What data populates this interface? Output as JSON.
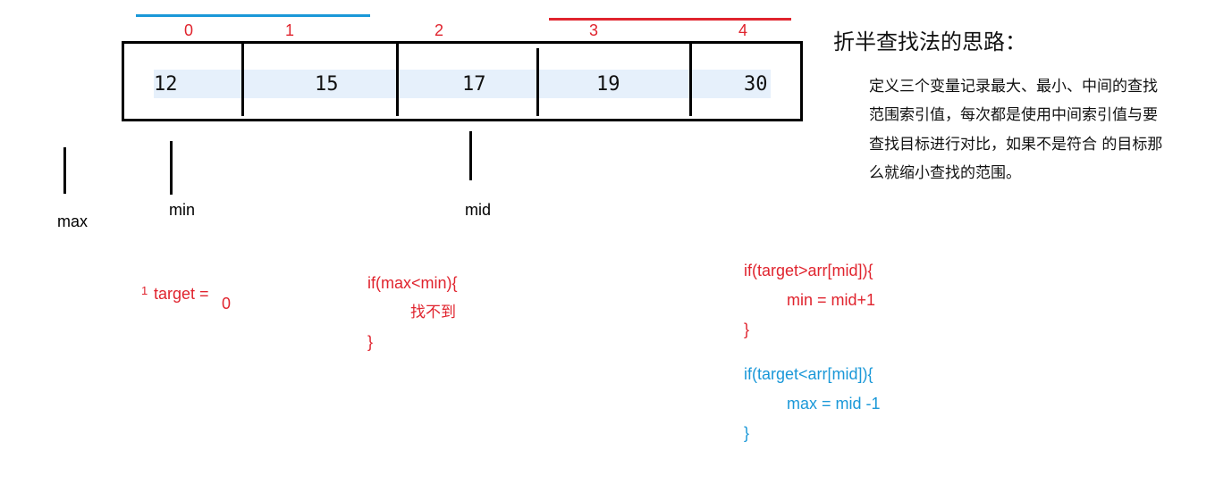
{
  "colors": {
    "blue_range": "#1a98d8",
    "red_range": "#e0242e",
    "cell_highlight": "#e6f0fb",
    "text": "#111111"
  },
  "indices": [
    "0",
    "1",
    "2",
    "3",
    "4"
  ],
  "array": [
    "12",
    "15",
    "17",
    "19",
    "30"
  ],
  "pointers": {
    "max": "max",
    "min": "min",
    "mid": "mid"
  },
  "target": {
    "marker": "1",
    "label": "target =",
    "value": "0"
  },
  "not_found": {
    "line1": "if(max<min){",
    "line2": "找不到",
    "line3": "}"
  },
  "greater": {
    "line1": "if(target>arr[mid]){",
    "line2": "min = mid+1",
    "line3": "}"
  },
  "less": {
    "line1": "if(target<arr[mid]){",
    "line2": "max = mid -1",
    "line3": "}"
  },
  "explanation": {
    "title": "折半查找法的思路：",
    "lines": [
      "定义三个变量记录最大、最小、中间的查找",
      "范围索引值，每次都是使用中间索引值与要",
      "查找目标进行对比，如果不是符合 的目标那",
      "么就缩小查找的范围。"
    ]
  }
}
